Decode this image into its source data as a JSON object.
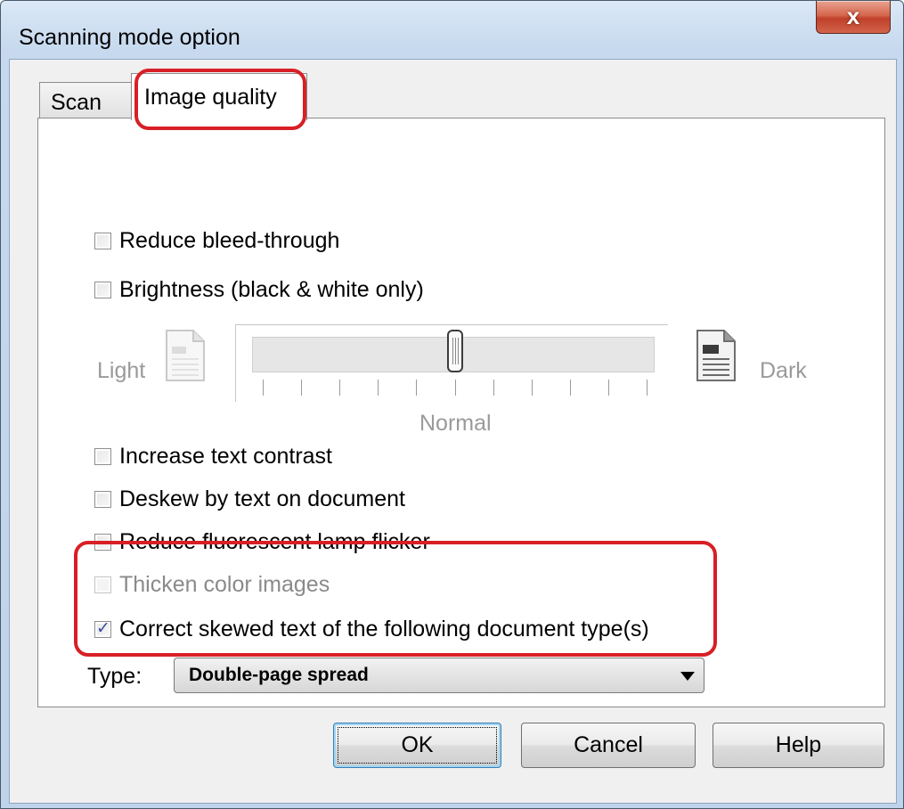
{
  "window": {
    "title": "Scanning mode option",
    "close_glyph": "x"
  },
  "tabs": [
    {
      "label": "Scan",
      "selected": false
    },
    {
      "label": "Image quality",
      "selected": true
    }
  ],
  "options": {
    "reduce_bleed": {
      "label": "Reduce bleed-through",
      "checked": false
    },
    "brightness": {
      "label": "Brightness (black & white only)",
      "checked": false
    },
    "increase_contrast": {
      "label": "Increase text contrast",
      "checked": false
    },
    "deskew": {
      "label": "Deskew by text on document",
      "checked": false
    },
    "flicker": {
      "label": "Reduce fluorescent lamp flicker",
      "checked": false
    },
    "thicken": {
      "label": "Thicken color images",
      "checked": false,
      "enabled": false
    },
    "correct_skew": {
      "label": "Correct skewed text of the following document type(s)",
      "checked": true
    }
  },
  "brightness_slider": {
    "min_label": "Light",
    "max_label": "Dark",
    "center_label": "Normal",
    "tick_count": 11,
    "value_fraction": 0.5,
    "enabled": false
  },
  "type_select": {
    "label": "Type:",
    "value": "Double-page spread"
  },
  "buttons": {
    "ok": "OK",
    "cancel": "Cancel",
    "help": "Help"
  },
  "colors": {
    "highlight": "#d81f26",
    "check": "#3a4da0"
  }
}
